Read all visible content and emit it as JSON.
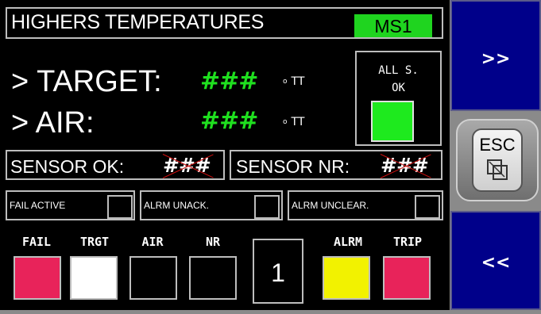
{
  "header": {
    "title": "HIGHERS TEMPERATURES",
    "badge": "MS1"
  },
  "readings": {
    "target_label": "> TARGET:",
    "target_value": "###",
    "target_unit": "TT",
    "air_label": "> AIR:",
    "air_value": "###",
    "air_unit": "TT"
  },
  "all_sensors": {
    "line1": "ALL S.",
    "line2": "OK",
    "lamp_color": "#1eea1e"
  },
  "sensors": {
    "ok_label": "SENSOR OK:",
    "ok_value": "###",
    "nr_label": "SENSOR NR:",
    "nr_value": "###"
  },
  "alarms": {
    "fail_active": "FAIL ACTIVE",
    "alrm_unack": "ALRM UNACK.",
    "alrm_unclear": "ALRM UNCLEAR."
  },
  "indicators": [
    {
      "label": "FAIL",
      "color": "#e8235a"
    },
    {
      "label": "TRGT",
      "color": "#ffffff"
    },
    {
      "label": "AIR",
      "color": "#000000"
    },
    {
      "label": "NR",
      "color": "#000000"
    },
    {
      "label": "ALRM",
      "color": "#f2f200"
    },
    {
      "label": "TRIP",
      "color": "#e8235a"
    }
  ],
  "counter": "1",
  "nav": {
    "next": ">>",
    "esc": "ESC",
    "prev": "<<"
  }
}
